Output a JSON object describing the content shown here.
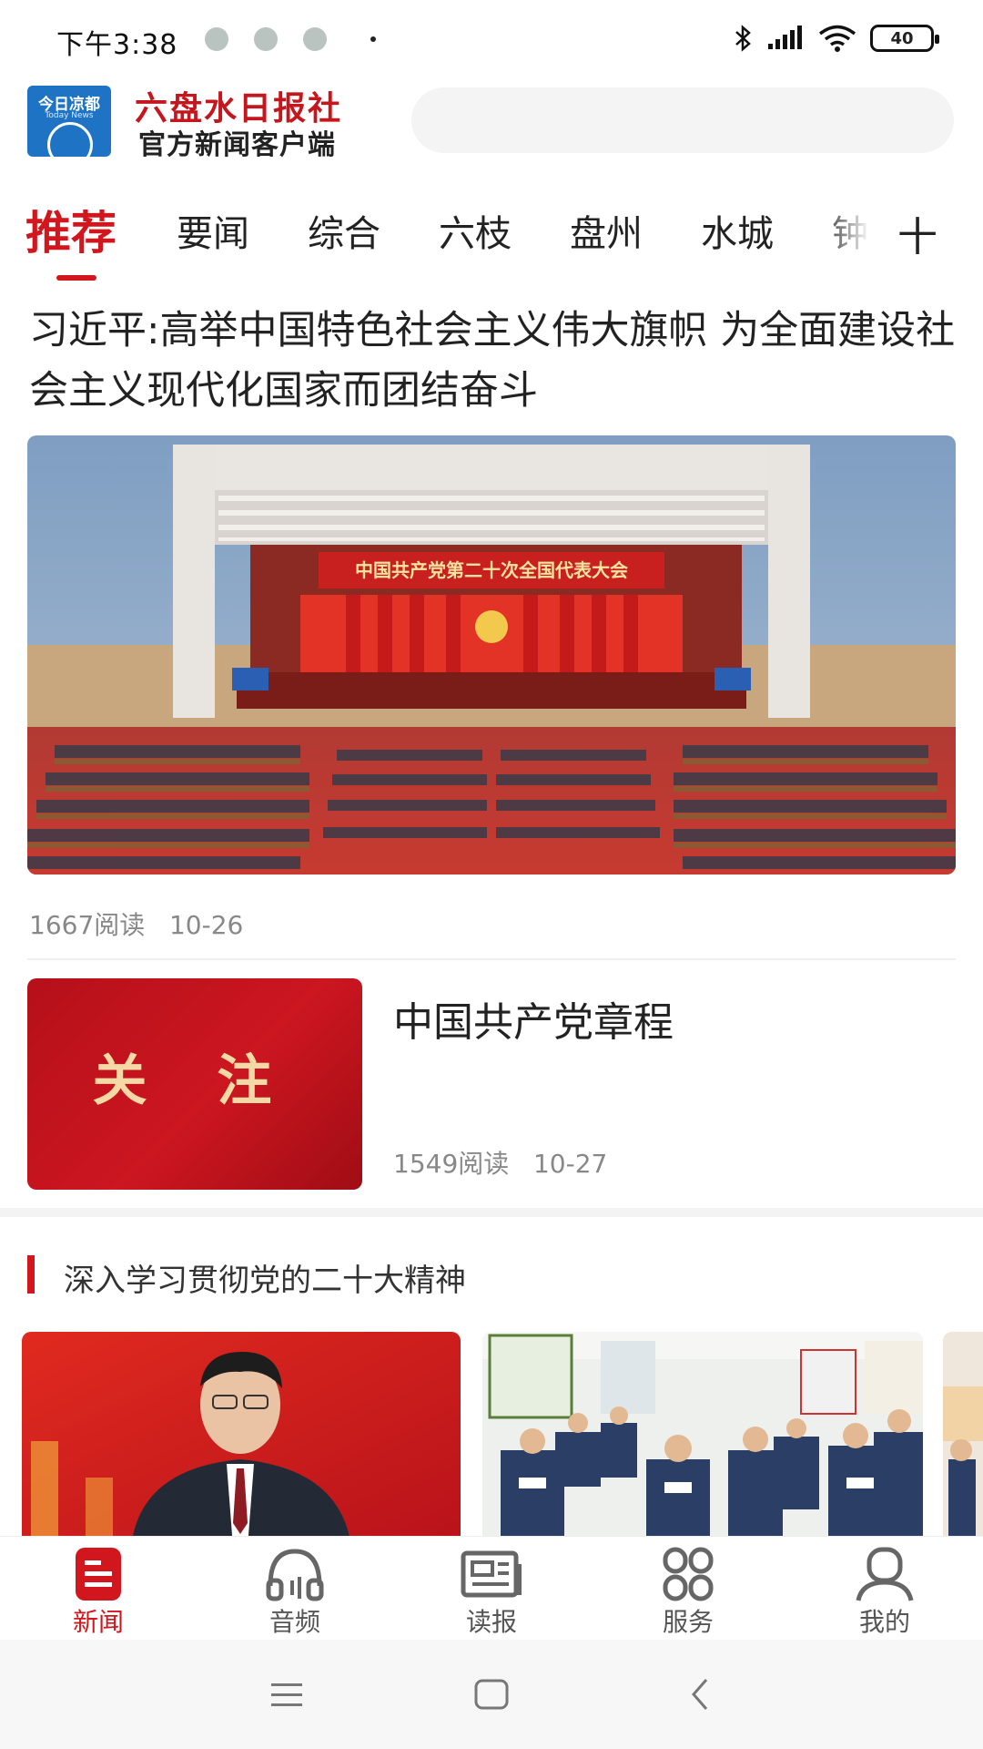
{
  "status_bar": {
    "time": "下午3:38",
    "battery": "40"
  },
  "header": {
    "logo_title": "今日凉都",
    "logo_subtitle": "Today News",
    "brand_title": "六盘水日报社",
    "brand_subtitle": "官方新闻客户端"
  },
  "tabs": {
    "items": [
      "推荐",
      "要闻",
      "综合",
      "六枝",
      "盘州",
      "水城",
      "钟"
    ],
    "add_label": "十",
    "active_index": 0
  },
  "feed": {
    "headline": {
      "title": "习近平:高举中国特色社会主义伟大旗帜 为全面建设社会主义现代化国家而团结奋斗",
      "image_banner": "中国共产党第二十次全国代表大会",
      "reads": "1667阅读",
      "date": "10-26"
    },
    "article2": {
      "thumb_text": "关 注",
      "title": "中国共产党章程",
      "reads": "1549阅读",
      "date": "10-27"
    },
    "section": {
      "title": "深入学习贯彻党的二十大精神"
    }
  },
  "bottom_nav": {
    "items": [
      {
        "label": "新闻",
        "icon": "news-icon",
        "active": true
      },
      {
        "label": "音频",
        "icon": "headphones-icon",
        "active": false
      },
      {
        "label": "读报",
        "icon": "newspaper-icon",
        "active": false
      },
      {
        "label": "服务",
        "icon": "services-grid-icon",
        "active": false
      },
      {
        "label": "我的",
        "icon": "profile-icon",
        "active": false
      }
    ]
  },
  "colors": {
    "accent": "#d1161d",
    "brand_red": "#c4161c",
    "logo_blue": "#1e73c4"
  }
}
